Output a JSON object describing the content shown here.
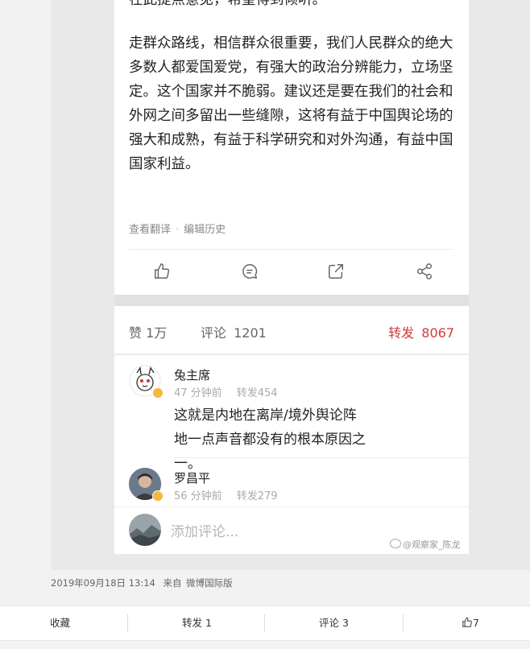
{
  "post": {
    "paragraph1": "在此提点意见，希望得到倾听。",
    "paragraph2": "走群众路线，相信群众很重要，我们人民群众的绝大多数人都爱国爱党，有强大的政治分辨能力，立场坚定。这个国家并不脆弱。建议还是要在我们的社会和外网之间多留出一些缝隙，这将有益于中国舆论场的强大和成熟，有益于科学研究和对外沟通，有益中国国家利益。",
    "view_translation": "查看翻译",
    "separator": "·",
    "edit_history": "编辑历史",
    "icons": [
      "thumbs-up-icon",
      "comment-icon",
      "share-icon",
      "network-share-icon"
    ]
  },
  "stats": {
    "likes_label": "赞",
    "likes_value": "1万",
    "comments_label": "评论",
    "comments_value": "1201",
    "reposts_label": "转发",
    "reposts_value": "8067",
    "repost_color": "#d13a3a"
  },
  "comments": [
    {
      "name": "兔主席",
      "time": "47 分钟前",
      "repost": "转发454",
      "text": "这就是内地在离岸/境外舆论阵地一点声音都没有的根本原因之一。"
    },
    {
      "name": "罗昌平",
      "time": "56 分钟前",
      "repost": "转发279"
    }
  ],
  "add_comment_placeholder": "添加评论...",
  "watermark": "@观察家_陈龙",
  "footer": {
    "date": "2019年09月18日 13:14",
    "source_prefix": "来自",
    "source": "微博国际版"
  },
  "bottom_bar": {
    "favorite": "收藏",
    "repost": "转发 1",
    "comment": "评论 3",
    "like": "7"
  }
}
